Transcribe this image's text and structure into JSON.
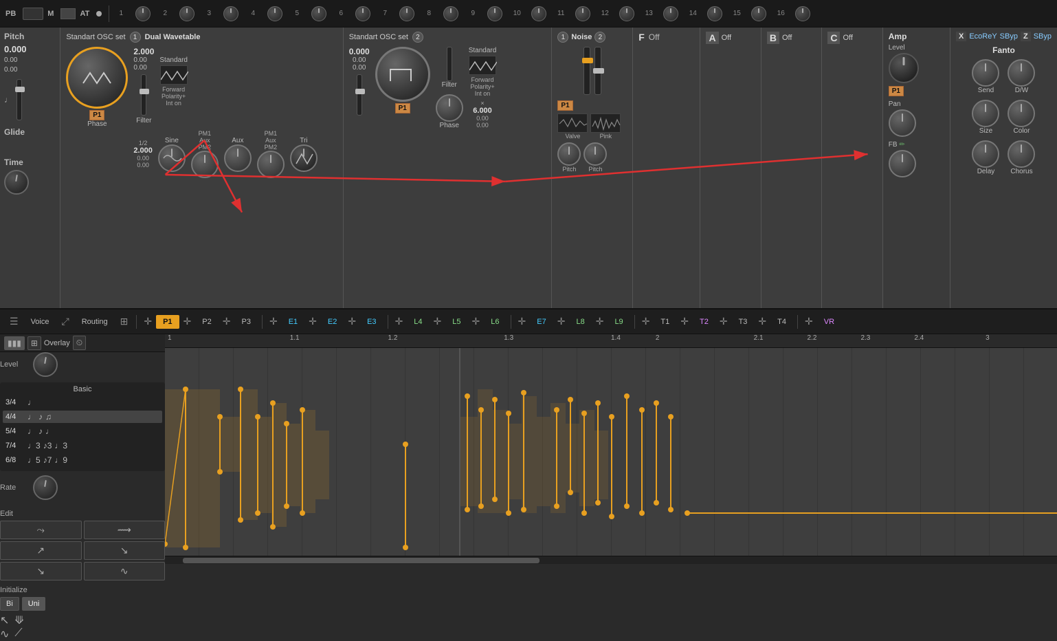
{
  "topbar": {
    "pb_label": "PB",
    "m_label": "M",
    "at_label": "AT",
    "knobs": [
      {
        "num": "1"
      },
      {
        "num": "2"
      },
      {
        "num": "3"
      },
      {
        "num": "4"
      },
      {
        "num": "5"
      },
      {
        "num": "6"
      },
      {
        "num": "7"
      },
      {
        "num": "8"
      },
      {
        "num": "9"
      },
      {
        "num": "10"
      },
      {
        "num": "11"
      },
      {
        "num": "12"
      },
      {
        "num": "13"
      },
      {
        "num": "14"
      },
      {
        "num": "15"
      },
      {
        "num": "16"
      }
    ]
  },
  "synth": {
    "pitch_title": "Pitch",
    "pitch_value": "0.000",
    "pitch_sub1": "0.00",
    "pitch_sub2": "0.00",
    "osc1_header": "Standart OSC set",
    "osc1_num": "1",
    "osc1_type": "Dual Wavetable",
    "osc2_header": "Standart OSC set",
    "osc2_num": "2",
    "osc1_filter_label": "Filter",
    "osc1_phase_label": "Phase",
    "osc1_p1_label": "P1",
    "osc1_standard_label": "Standard",
    "osc1_forward_label": "Forward",
    "osc1_polarity_label": "Polarity+",
    "osc1_int_label": "Int on",
    "osc1_sine_label": "Sine",
    "osc1_pm1_label": "PM1",
    "osc1_aux_label": "Aux",
    "osc1_pm2_label": "PM2",
    "osc1_tri_label": "Tri",
    "osc1_half_label": "1/2",
    "osc1_freq_value": "2.000",
    "osc1_freq_sub1": "0.00",
    "osc1_freq_sub2": "0.00",
    "osc2_filter_label": "Filter",
    "osc2_phase_label": "Phase",
    "osc2_p1_label": "P1",
    "osc2_value1": "0.000",
    "osc2_standard_label": "Standard",
    "osc2_forward_label": "Forward",
    "osc2_polarity_label": "Polarity+",
    "osc2_int_label": "Int on",
    "osc2_freq_value": "6.000",
    "noise_title": "Noise",
    "noise_num1": "1",
    "noise_num2": "2",
    "noise_valve_label": "Valve",
    "noise_pink_label": "Pink",
    "noise_pitch_label1": "Pitch",
    "noise_pitch_label2": "Pitch",
    "noise_p1_label": "P1",
    "filter_label": "F",
    "filter_off": "Off",
    "env_a_label": "A",
    "env_a_off": "Off",
    "env_b_label": "B",
    "env_b_off": "Off",
    "env_c_label": "C",
    "env_c_off": "Off",
    "amp_title": "Amp",
    "amp_level_label": "Level",
    "amp_pan_label": "Pan",
    "amp_fb_label": "FB",
    "amp_p1_label": "P1",
    "fx_x_label": "X",
    "fx_ecoreY": "EcoReY",
    "fx_sbyp": "SByp",
    "fx_z": "Z",
    "fx_sbyp2": "SByp",
    "fx_fanto": "Fanto",
    "fx_send_label": "Send",
    "fx_dw_label": "D/W",
    "fx_size_label": "Size",
    "fx_color_label": "Color",
    "fx_delay_label": "Delay",
    "fx_chorus_label": "Chorus",
    "glide_label": "Glide",
    "glide_time_label": "Time"
  },
  "tabs": {
    "voice_label": "Voice",
    "routing_label": "Routing",
    "p1_label": "P1",
    "p2_label": "P2",
    "p3_label": "P3",
    "e1_label": "E1",
    "e2_label": "E2",
    "e3_label": "E3",
    "l4_label": "L4",
    "l5_label": "L5",
    "l6_label": "L6",
    "e7_label": "E7",
    "l8_label": "L8",
    "l9_label": "L9",
    "t1_label": "T1",
    "t2_label": "T2",
    "t3_label": "T3",
    "t4_label": "T4",
    "vr_label": "VR"
  },
  "bottom": {
    "level_label": "Level",
    "rate_label": "Rate",
    "overlay_label": "Overlay",
    "basic_label": "Basic",
    "time_sigs": [
      {
        "label": "3/4",
        "notes": "♩"
      },
      {
        "label": "4/4",
        "notes": "♩ ♪ ♫",
        "active": true
      },
      {
        "label": "5/4",
        "notes": "♩ ♪ ♩"
      },
      {
        "label": "7/4",
        "notes": "♩3 ♪3 ♩3"
      },
      {
        "label": "6/8",
        "notes": "♩5 ♪7 ♩9"
      }
    ],
    "edit_label": "Edit",
    "initialize_label": "Initialize",
    "bi_label": "Bi",
    "uni_label": "Uni",
    "timeline_markers": [
      "1",
      "1.1",
      "1.2",
      "1.3",
      "1.4",
      "2",
      "2.1",
      "2.2",
      "2.3",
      "2.4",
      "3"
    ]
  }
}
